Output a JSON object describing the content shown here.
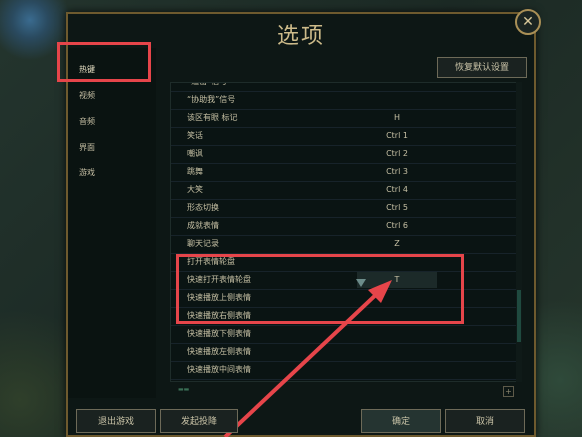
{
  "dialog": {
    "title": "选项",
    "close_icon": "close-icon"
  },
  "sidebar": {
    "items": [
      {
        "label": "热键",
        "active": true
      },
      {
        "label": "视频"
      },
      {
        "label": "音频"
      },
      {
        "label": "界面"
      },
      {
        "label": "游戏"
      }
    ]
  },
  "toolbar": {
    "restore_defaults_label": "恢复默认设置"
  },
  "hotkeys": [
    {
      "label": "“追击”信号",
      "key": ""
    },
    {
      "label": "“协助我”信号",
      "key": ""
    },
    {
      "label": "该区有眼 标记",
      "key": "H"
    },
    {
      "label": "笑话",
      "key": "Ctrl 1"
    },
    {
      "label": "嘲讽",
      "key": "Ctrl 2"
    },
    {
      "label": "跳舞",
      "key": "Ctrl 3"
    },
    {
      "label": "大笑",
      "key": "Ctrl 4"
    },
    {
      "label": "形态切换",
      "key": "Ctrl 5"
    },
    {
      "label": "成就表情",
      "key": "Ctrl 6"
    },
    {
      "label": "聊天记录",
      "key": "Z"
    },
    {
      "label": "打开表情轮盘",
      "key": ""
    },
    {
      "label": "快速打开表情轮盘",
      "key": "T",
      "selected": true
    },
    {
      "label": "快速播放上侧表情",
      "key": ""
    },
    {
      "label": "快速播放右侧表情",
      "key": ""
    },
    {
      "label": "快速播放下侧表情",
      "key": ""
    },
    {
      "label": "快速播放左侧表情",
      "key": ""
    },
    {
      "label": "快速播放中间表情",
      "key": ""
    }
  ],
  "footer": {
    "exit_label": "退出游戏",
    "surrender_label": "发起投降",
    "ok_label": "确定",
    "cancel_label": "取消"
  },
  "colors": {
    "annotation": "#e6454a",
    "gold": "#cdbb8a"
  }
}
